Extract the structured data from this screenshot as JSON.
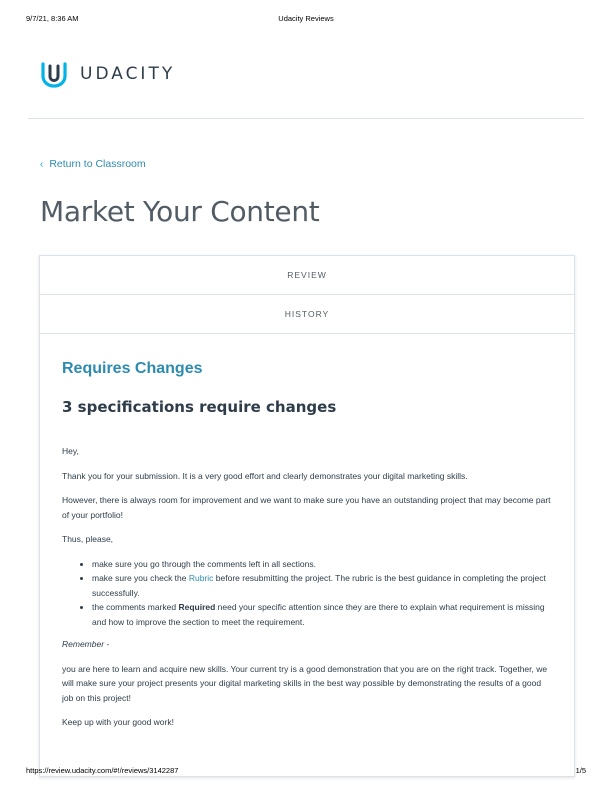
{
  "print": {
    "datetime": "9/7/21, 8:36 AM",
    "doc_title": "Udacity Reviews",
    "url": "https://review.udacity.com/#!/reviews/3142287",
    "page": "1/5"
  },
  "brand": {
    "name": "UDACITY",
    "colors": {
      "accent": "#02b3e4",
      "link": "#2e8bb0",
      "text": "#2e3d49"
    }
  },
  "nav": {
    "back_label": "Return to Classroom",
    "back_icon": "chevron-left-icon"
  },
  "page": {
    "title": "Market Your Content"
  },
  "tabs": [
    {
      "label": "REVIEW"
    },
    {
      "label": "HISTORY"
    }
  ],
  "review": {
    "status": "Requires Changes",
    "spec_count": "3 specifications require changes",
    "greeting": "Hey,",
    "p1": "Thank you for your submission. It is a very good effort and clearly demonstrates your digital marketing skills.",
    "p2": "However, there is always room for improvement and we want to make sure you have an outstanding project that may become part of your portfolio!",
    "p3": "Thus, please,",
    "bullet1": "make sure you go through the comments left in all sections.",
    "bullet2_pre": "make sure you check the ",
    "bullet2_link": "Rubric",
    "bullet2_post": " before resubmitting the project. The rubric is the best guidance in completing the project successfully.",
    "bullet3_pre": "the comments marked ",
    "bullet3_bold": "Required",
    "bullet3_post": " need your specific attention since they are there to explain what requirement is missing and how to improve the section to meet the requirement.",
    "remember": "Remember -",
    "p4": "you are here to learn and acquire new skills. Your current try is a good demonstration that you are on the right track. Together, we will make sure your project presents your digital marketing skills in the best way possible by demonstrating the results of a good job on this project!",
    "closing": "Keep up with your good work!"
  }
}
